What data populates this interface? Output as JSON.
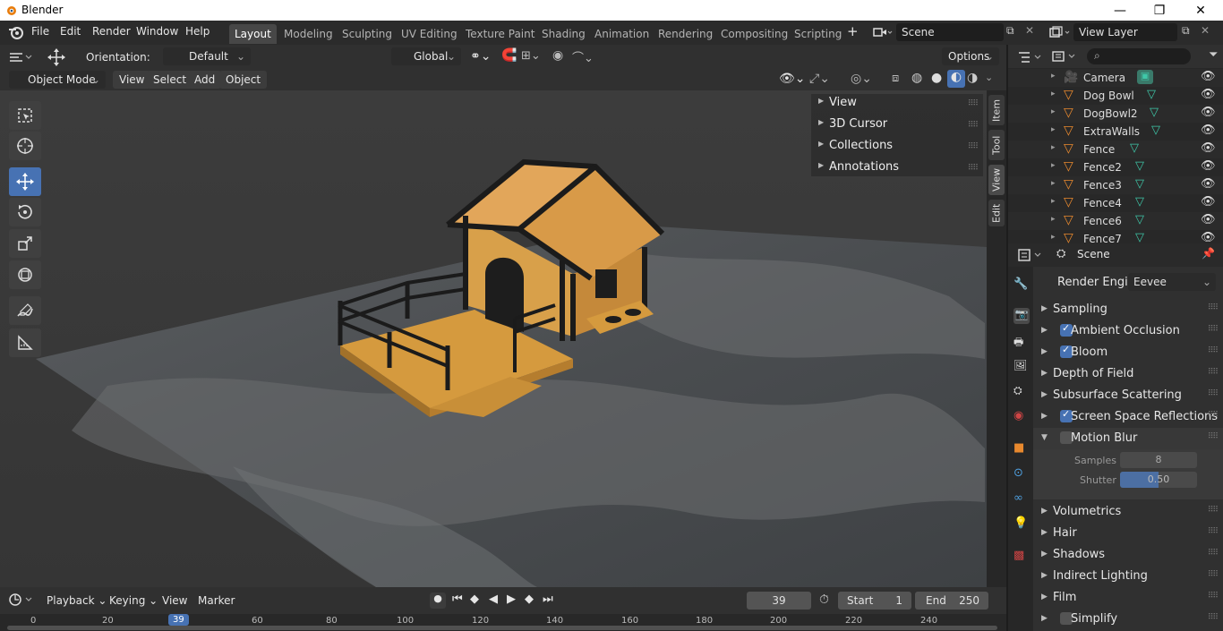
{
  "window": {
    "title": "Blender",
    "minimize": "—",
    "maximize": "❐",
    "close": "✕"
  },
  "menu": {
    "items": [
      "File",
      "Edit",
      "Render",
      "Window",
      "Help"
    ]
  },
  "workspaces": [
    "Layout",
    "Modeling",
    "Sculpting",
    "UV Editing",
    "Texture Paint",
    "Shading",
    "Animation",
    "Rendering",
    "Compositing",
    "Scripting"
  ],
  "scene_field": "Scene",
  "view_layer_field": "View Layer",
  "tool_header": {
    "orientation_label": "Orientation:",
    "orientation_value": "Default",
    "transform_orientation": "Global",
    "options_label": "Options"
  },
  "viewport_header": {
    "mode": "Object Mode",
    "view": "View",
    "select": "Select",
    "add": "Add",
    "object": "Object"
  },
  "n_panel": {
    "items": [
      "View",
      "3D Cursor",
      "Collections",
      "Annotations"
    ]
  },
  "n_tabs": [
    "Item",
    "Tool",
    "View",
    "Edit"
  ],
  "timeline": {
    "playback": "Playback",
    "keying": "Keying",
    "view": "View",
    "marker": "Marker",
    "current_frame": "39",
    "start_label": "Start",
    "start": "1",
    "end_label": "End",
    "end": "250",
    "ticks": [
      "0",
      "20",
      "39",
      "60",
      "80",
      "100",
      "120",
      "140",
      "160",
      "180",
      "200",
      "220",
      "240"
    ]
  },
  "outliner": {
    "objects": [
      "Camera",
      "Dog Bowl",
      "DogBowl2",
      "ExtraWalls",
      "Fence",
      "Fence2",
      "Fence3",
      "Fence4",
      "Fence6",
      "Fence7"
    ]
  },
  "properties": {
    "context": "Scene",
    "render_engine_label": "Render Engine",
    "render_engine": "Eevee",
    "panels": [
      {
        "label": "Sampling",
        "checkbox": null,
        "expanded": false
      },
      {
        "label": "Ambient Occlusion",
        "checkbox": true,
        "expanded": false
      },
      {
        "label": "Bloom",
        "checkbox": true,
        "expanded": false
      },
      {
        "label": "Depth of Field",
        "checkbox": null,
        "expanded": false
      },
      {
        "label": "Subsurface Scattering",
        "checkbox": null,
        "expanded": false
      },
      {
        "label": "Screen Space Reflections",
        "checkbox": true,
        "expanded": false
      },
      {
        "label": "Motion Blur",
        "checkbox": false,
        "expanded": true
      }
    ],
    "motion_blur": {
      "samples_label": "Samples",
      "samples": "8",
      "shutter_label": "Shutter",
      "shutter": "0.50"
    },
    "panels_after": [
      "Volumetrics",
      "Hair",
      "Shadows",
      "Indirect Lighting",
      "Film",
      "Simplify"
    ],
    "simplify_checkbox": false
  },
  "colors": {
    "accent": "#4772b3",
    "object_orange": "#e8892e",
    "mesh_green": "#3fc7a8"
  }
}
